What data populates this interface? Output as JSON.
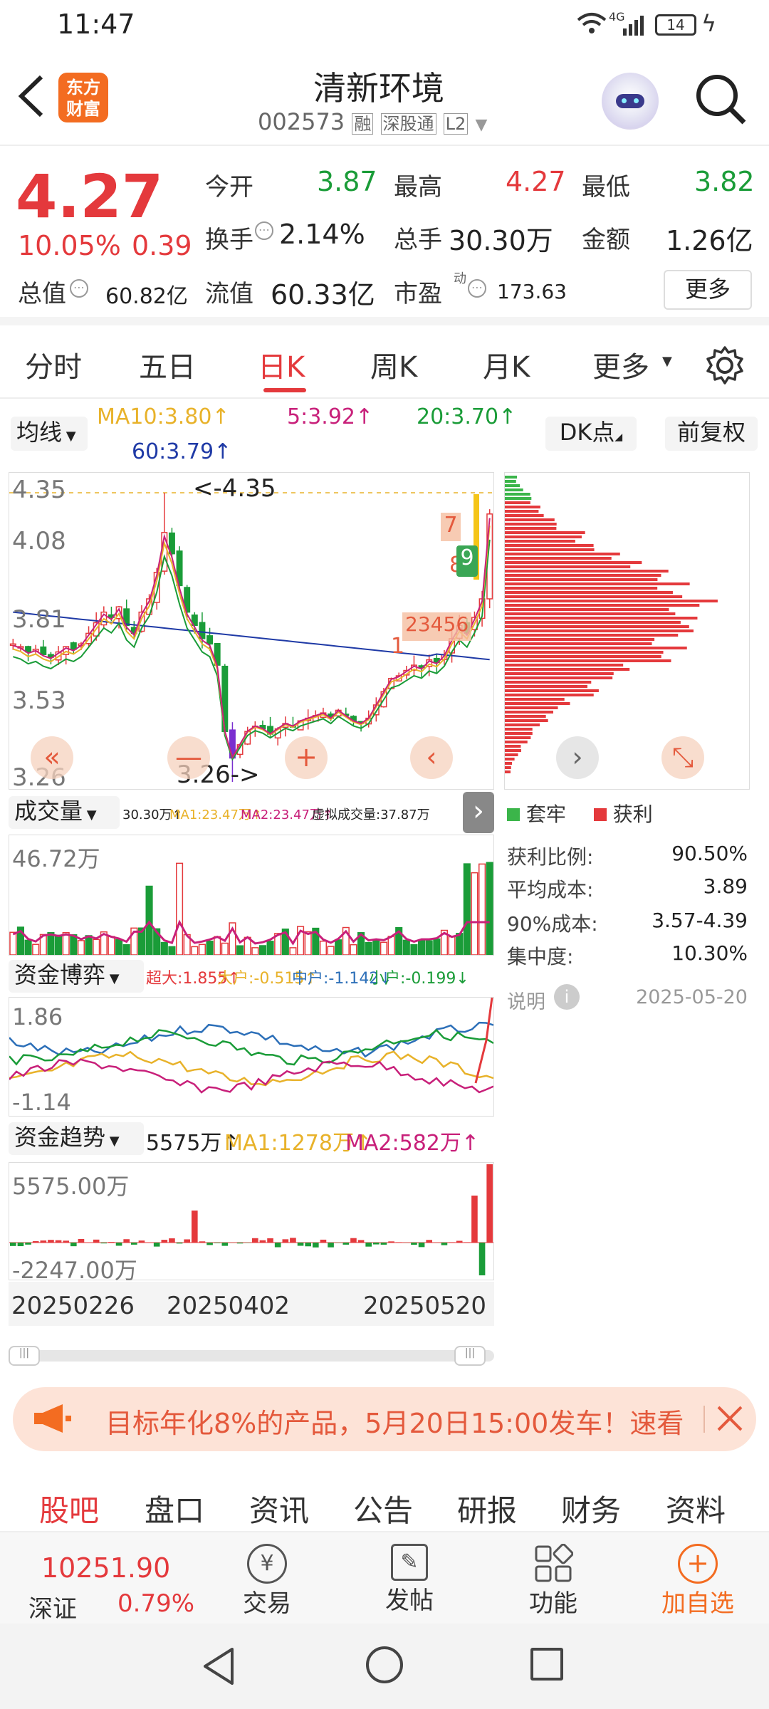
{
  "status": {
    "time": "11:47",
    "network": "4G",
    "battery": "14"
  },
  "header": {
    "title": "清新环境",
    "code": "002573",
    "tags": [
      "融",
      "深股通",
      "L2"
    ],
    "logo_text": "东方财富"
  },
  "quote": {
    "price": "4.27",
    "change_pct": "10.05%",
    "change": "0.39",
    "open_label": "今开",
    "open": "3.87",
    "high_label": "最高",
    "high": "4.27",
    "low_label": "最低",
    "low": "3.82",
    "turnover_label": "换手",
    "turnover": "2.14%",
    "volume_label": "总手",
    "volume": "30.30万",
    "amount_label": "金额",
    "amount": "1.26亿",
    "mktcap_label": "总值",
    "mktcap": "60.82亿",
    "float_label": "流值",
    "float": "60.33亿",
    "pe_label": "市盈",
    "pe_sup": "动",
    "pe": "173.63",
    "more_label": "更多"
  },
  "tabs": [
    "分时",
    "五日",
    "日K",
    "周K",
    "月K",
    "更多"
  ],
  "active_tab": "日K",
  "ma_bar": {
    "selector": "均线",
    "ma10": "MA10:3.80↑",
    "ma5": "5:3.92↑",
    "ma20": "20:3.70↑",
    "ma60": "60:3.79↑",
    "dk": "DK点",
    "fq": "前复权"
  },
  "kline": {
    "y_labels": [
      "4.35",
      "4.08",
      "3.81",
      "3.53",
      "3.26"
    ],
    "high_marker": "<-4.35",
    "low_marker": "3.26->",
    "signals": [
      "7",
      "8",
      "9",
      "1",
      "2",
      "3",
      "4",
      "5",
      "6"
    ],
    "buttons": [
      "«",
      "—",
      "+",
      "‹"
    ]
  },
  "chip": {
    "legend_trapped": "套牢",
    "legend_profit": "获利",
    "stats": [
      {
        "label": "获利比例:",
        "value": "90.50%"
      },
      {
        "label": "平均成本:",
        "value": "3.89"
      },
      {
        "label": "90%成本:",
        "value": "3.57-4.39"
      },
      {
        "label": "集中度:",
        "value": "10.30%"
      }
    ],
    "note_label": "说明",
    "date": "2025-05-20",
    "buttons": [
      "›",
      "⤡"
    ]
  },
  "volume": {
    "selector": "成交量",
    "vol": "30.30万↑",
    "ma1": "MA1:23.47万↑",
    "ma2": "MA2:23.47万↑",
    "virtual": "虚拟成交量:37.87万",
    "y_top": "46.72万"
  },
  "fund_game": {
    "selector": "资金博弈",
    "super": "超大:1.855↑",
    "big": "大户:-0.515↑",
    "mid": "中户:-1.142↓",
    "small": "小户:-0.199↓",
    "y_top": "1.86",
    "y_bottom": "-1.14"
  },
  "fund_trend": {
    "selector": "资金趋势",
    "value": "5575万↑",
    "ma1": "MA1:1278万↑",
    "ma2": "MA2:582万↑",
    "y_top": "5575.00万",
    "y_bottom": "-2247.00万"
  },
  "dates": [
    "20250226",
    "20250402",
    "20250520"
  ],
  "banner": {
    "text": "目标年化8%的产品，5月20日15:00发车！速看"
  },
  "bottom_tabs": [
    "股吧",
    "盘口",
    "资讯",
    "公告",
    "研报",
    "财务",
    "资料"
  ],
  "active_bottom_tab": "股吧",
  "toolbar": {
    "index_value": "10251.90",
    "index_name": "深证",
    "index_pct": "0.79%",
    "trade": "交易",
    "post": "发帖",
    "func": "功能",
    "add": "加自选"
  },
  "colors": {
    "up": "#e4393c",
    "down": "#1a9c38",
    "accent": "#f36c21"
  }
}
